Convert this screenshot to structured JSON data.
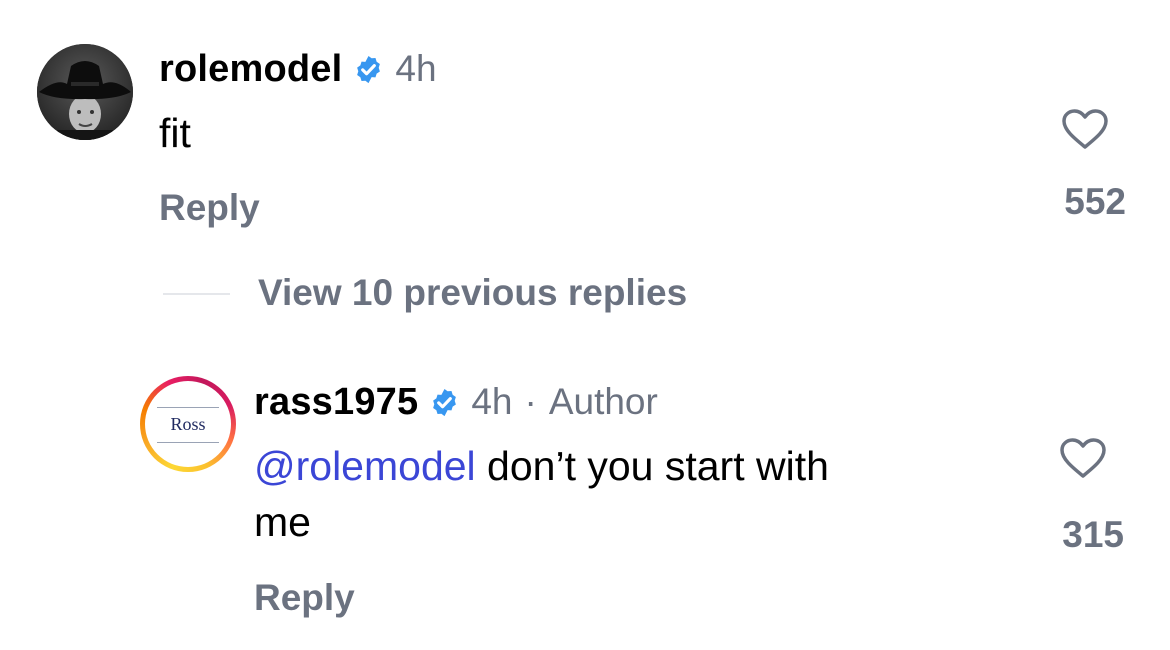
{
  "comments": [
    {
      "username": "rolemodel",
      "verified": true,
      "time": "4h",
      "text": "fit",
      "reply_label": "Reply",
      "likes": "552",
      "avatar_icon": "cowboy-hat-photo"
    }
  ],
  "thread": {
    "view_previous_label": "View 10 previous replies"
  },
  "replies": [
    {
      "username": "rass1975",
      "verified": true,
      "time": "4h",
      "separator": "·",
      "author_tag": "Author",
      "mention": "@rolemodel",
      "text_line1": " don’t you start with",
      "text_line2": "me",
      "reply_label": "Reply",
      "likes": "315",
      "avatar_text": "Ross"
    }
  ],
  "colors": {
    "verified_badge": "#3897f0",
    "mention": "#3b46d6",
    "secondary_text": "#6b7280"
  }
}
